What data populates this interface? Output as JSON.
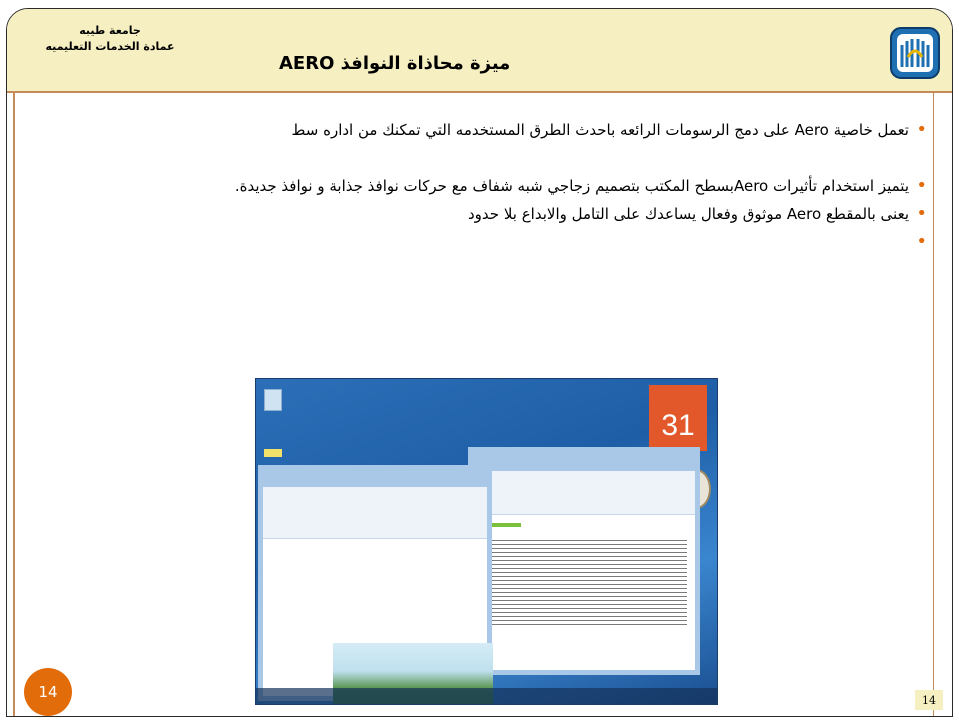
{
  "header": {
    "university_line1": "جامعة طيبه",
    "university_line2": "عمادة الخدمات التعليميه",
    "title": "ميزة محاذاة النوافذ AERO"
  },
  "bullets": [
    "تعمل خاصية Aero على دمج الرسومات الرائعه باحدث الطرق المستخدمه التي تمكنك من اداره سط",
    "يتميز استخدام تأثيرات Aeroبسطح المكتب بتصميم زجاجي شبه شفاف مع حركات نوافذ جذابة و نوافذ جديدة.",
    "يعنى بالمقطع Aero موثوق وفعال يساعدك على التامل والابداع بلا حدود",
    ""
  ],
  "screenshot": {
    "calendar_day": "31"
  },
  "footer": {
    "slide_number_badge": "14",
    "page_number": "14"
  },
  "colors": {
    "header_band": "#f6efc1",
    "accent_orange": "#e36c0a",
    "rule_brown": "#c48a5a"
  }
}
